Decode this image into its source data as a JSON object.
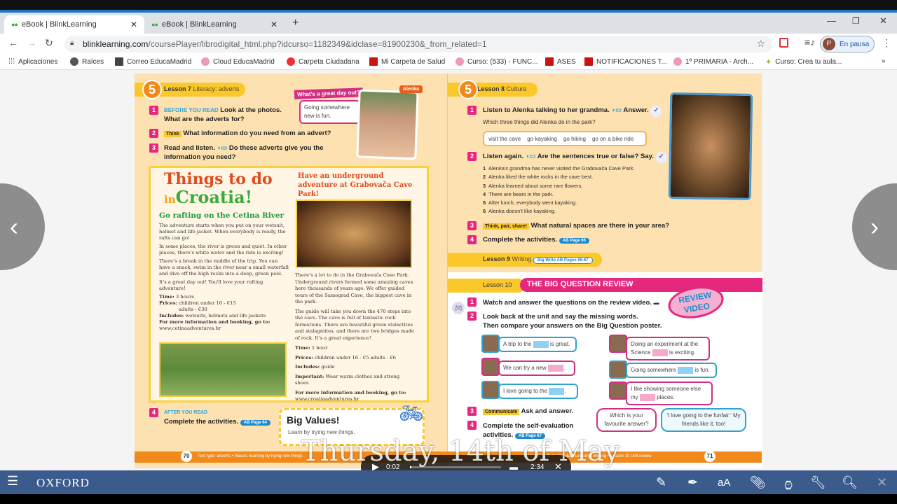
{
  "browser": {
    "tabs": [
      {
        "label": "eBook | BlinkLearning",
        "active": true
      },
      {
        "label": "eBook | BlinkLearning",
        "active": false
      }
    ],
    "new_tab": "+",
    "url_host": "blinklearning.com",
    "url_path": "/coursePlayer/librodigital_html.php?idcurso=1182349&idclase=81900230&_from_related=1",
    "profile_label": "En pausa",
    "profile_initial": "P",
    "bookmarks": [
      "Aplicaciones",
      "Raíces",
      "Correo EducaMadrid",
      "Cloud EducaMadrid",
      "Carpeta Ciudadana",
      "Mi Carpeta de Salud",
      "Curso: (533) - FUNC...",
      "ASES",
      "NOTIFICACIONES T...",
      "1º PRIMARIA - Arch...",
      "Curso: Crea tu aula..."
    ],
    "more": "»"
  },
  "left_page": {
    "unit": "5",
    "lesson": "Lesson 7",
    "lesson_topic": "Literacy: adverts",
    "q1_tag": "BEFORE YOU READ",
    "q1": "Look at the photos. What are the adverts for?",
    "q2_tag": "Think",
    "q2": "What information do you need from an advert?",
    "q3": "Read and listen.",
    "q3b": "Do these adverts give you the information you need?",
    "speech_title": "What's a great day out?",
    "speech_text": "Going somewhere new is fun.",
    "character": "Alenka",
    "title1": "Things to do",
    "title2_in": "in",
    "title2": "Croatia!",
    "rafting_title": "Go rafting on the Cetina River",
    "rafting_paras": [
      "The adventure starts when you put on your wetsuit, helmet and life jacket. When everybody is ready, the rafts can go!",
      "In some places, the river is green and quiet. In other places, there's white water and the ride is exciting!",
      "There's a break in the middle of the trip. You can have a snack, swim in the river near a small waterfall and dive off the high rocks into a deep, green pool.",
      "It's a great day out! You'll love your rafting adventure!"
    ],
    "rafting_time": "Time:",
    "rafting_time_v": "3 hours",
    "rafting_prices": "Prices:",
    "rafting_prices_v": "children under 16 - €15",
    "rafting_prices_v2": "adults - €30",
    "rafting_includes": "Includes:",
    "rafting_includes_v": "wetsuits, helmets and life jackets",
    "more_info": "For more information and booking, go to:",
    "rafting_url": "www.cetinaadventures.hr",
    "cave_title": "Have an underground adventure at Grabovača Cave Park!",
    "cave_paras": [
      "There's a lot to do in the Grabovača Cave Park. Underground rivers formed some amazing caves here thousands of years ago. We offer guided tours of the Samograd Cave, the biggest cave in the park.",
      "The guide will take you down the 470 steps into the cave. The cave is full of fantastic rock formations. There are beautiful green stalactites and stalagmites, and there are two bridges made of rock. It's a great experience!"
    ],
    "cave_time": "Time:",
    "cave_time_v": "1 hour",
    "cave_prices": "Prices:",
    "cave_prices_v": "children under 16 - €5    adults - €6",
    "cave_includes": "Includes:",
    "cave_includes_v": "guide",
    "cave_important": "Important:",
    "cave_important_v": "Wear warm clothes and strong shoes",
    "cave_url": "www.croatiaadventures.hr",
    "q4_tag": "AFTER YOU READ",
    "q4": "Complete the activities.",
    "ab_page": "AB Page 64",
    "values_title": "Big Values!",
    "values_text": "Learn by trying new things.",
    "page_num": "70",
    "footer": "Text type: adverts • Values: learning by trying new things"
  },
  "right_page": {
    "unit": "5",
    "lesson": "Lesson 8",
    "lesson_topic": "Culture",
    "q1": "Listen to Alenka talking to her grandma.",
    "q1_answer": "Answer.",
    "q1_sub": "Which three things did Alenka do in the park?",
    "options": [
      "visit the cave",
      "go kayaking",
      "go hiking",
      "go on a bike ride"
    ],
    "q2": "Listen again.",
    "q2b": "Are the sentences true or false? Say.",
    "statements": [
      "Alenka's grandma has never visited the Grabovača Cave Park.",
      "Alenka liked the white rocks in the cave best.",
      "Alenka learned about some rare flowers.",
      "There are bears in the park.",
      "After lunch, everybody went kayaking.",
      "Alenka doesn't like kayaking."
    ],
    "q3_tag": "Think, pair, share!",
    "q3": "What natural spaces are there in your area?",
    "q4": "Complete the activities.",
    "ab_page": "AB Page 66",
    "lesson9": "Lesson 9",
    "lesson9_topic": "Writing",
    "lesson9_tag": "Big Write AB Pages 66-67",
    "lesson10": "Lesson 10",
    "lesson10_title": "THE BIG QUESTION REVIEW",
    "review_badge": "REVIEW VIDEO",
    "r1": "Watch and answer the questions on the review video.",
    "r2": "Look back at the unit and say the missing words.",
    "r2b": "Then compare your answers on the Big Question poster.",
    "sentences": [
      {
        "a": "A trip to the",
        "b": "is great."
      },
      {
        "a": "Doing an experiment at the Science",
        "b": "is exciting."
      },
      {
        "a": "We can try a new",
        "b": "."
      },
      {
        "a": "Going somewhere",
        "b": "is fun."
      },
      {
        "a": "I love going to the",
        "b": "."
      },
      {
        "a": "I like showing someone else my",
        "b": "places."
      }
    ],
    "r3_tag": "Communicate",
    "r3": "Ask and answer.",
    "r4": "Complete the self-evaluation activities.",
    "r4_ab": "AB Page 67",
    "bubble1": "Which is your favourite answer?",
    "bubble2": "'I love going to the funfair.' My friends like it, too!",
    "page_num": "71",
    "footer": "Lesson 8 Culture: Croatia • Lesson 9 Writing • Lesson 10 Unit review"
  },
  "video": {
    "overlay_title": "Thursday, 14th of May",
    "current": "0:02",
    "duration": "2:34",
    "progress": 0.013
  },
  "toolbar": {
    "brand": "OXFORD"
  }
}
